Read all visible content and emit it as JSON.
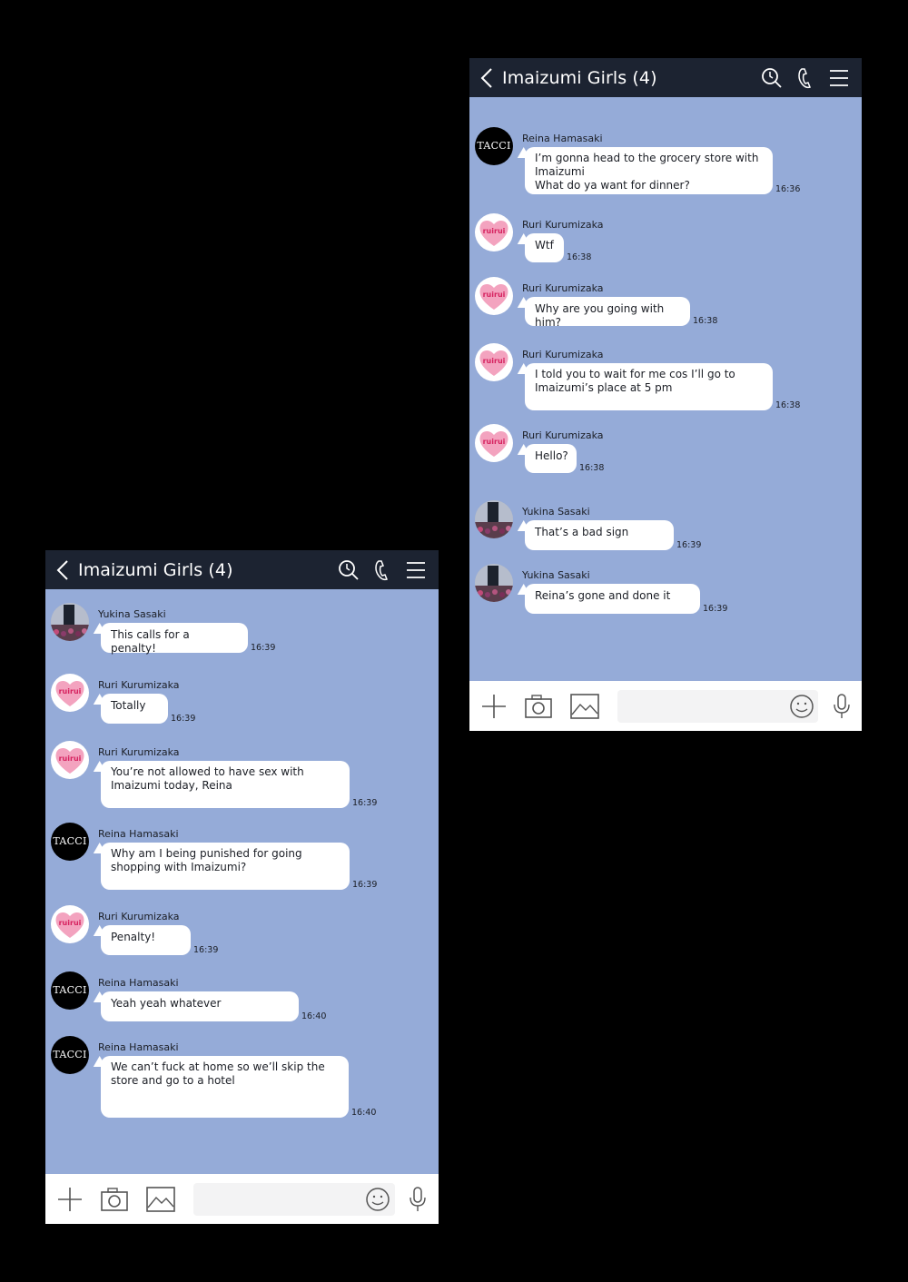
{
  "screens": [
    {
      "header": {
        "title": "Imaizumi Girls (4)"
      },
      "messages": [
        {
          "name": "Reina Hamasaki",
          "avatar": "TACCI",
          "text": "I’m gonna head to the grocery store with\nImaizumi\nWhat do ya want for dinner?",
          "time": "16:36"
        },
        {
          "name": "Ruri Kurumizaka",
          "avatar": "ruirui",
          "text": "Wtf",
          "time": "16:38"
        },
        {
          "name": "Ruri Kurumizaka",
          "avatar": "ruirui",
          "text": "Why are you going with him?",
          "time": "16:38"
        },
        {
          "name": "Ruri Kurumizaka",
          "avatar": "ruirui",
          "text": "I told you to wait for me cos I’ll go to\nImaizumi’s place at 5 pm",
          "time": "16:38"
        },
        {
          "name": "Ruri Kurumizaka",
          "avatar": "ruirui",
          "text": "Hello?",
          "time": "16:38"
        },
        {
          "name": "Yukina Sasaki",
          "avatar": "photo",
          "text": "That’s a bad sign",
          "time": "16:39"
        },
        {
          "name": "Yukina Sasaki",
          "avatar": "photo",
          "text": "Reina’s gone and done it",
          "time": "16:39"
        }
      ]
    },
    {
      "header": {
        "title": "Imaizumi Girls (4)"
      },
      "messages": [
        {
          "name": "Yukina Sasaki",
          "avatar": "photo",
          "text": "This calls for a penalty!",
          "time": "16:39"
        },
        {
          "name": "Ruri Kurumizaka",
          "avatar": "ruirui",
          "text": "Totally",
          "time": "16:39"
        },
        {
          "name": "Ruri Kurumizaka",
          "avatar": "ruirui",
          "text": "You’re not allowed to have sex with\nImaizumi today, Reina",
          "time": "16:39"
        },
        {
          "name": "Reina Hamasaki",
          "avatar": "TACCI",
          "text": "Why am I being punished for going\nshopping with Imaizumi?",
          "time": "16:39"
        },
        {
          "name": "Ruri Kurumizaka",
          "avatar": "ruirui",
          "text": "Penalty!",
          "time": "16:39"
        },
        {
          "name": "Reina Hamasaki",
          "avatar": "TACCI",
          "text": "Yeah yeah whatever",
          "time": "16:40"
        },
        {
          "name": "Reina Hamasaki",
          "avatar": "TACCI",
          "text": "We can’t fuck at home so we’ll skip the\nstore and go to a hotel",
          "time": "16:40"
        }
      ]
    }
  ],
  "icons": {
    "back": "chevron-left-icon",
    "search": "search-icon",
    "call": "phone-icon",
    "menu": "menu-icon",
    "add": "plus-icon",
    "camera": "camera-icon",
    "image": "image-icon",
    "emoji": "smiley-icon",
    "mic": "microphone-icon"
  },
  "colors": {
    "header": "#1c2331",
    "chat_bg": "#95abd8",
    "bubble": "#ffffff",
    "heart": "#f3a3bf"
  }
}
